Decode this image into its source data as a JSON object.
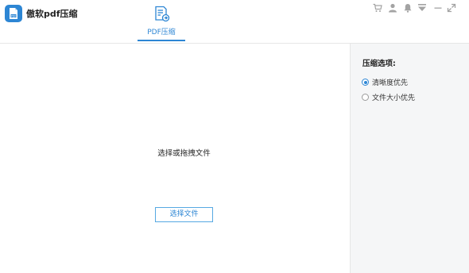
{
  "app": {
    "title": "傲软pdf压缩",
    "logo_icon": "pdf-file-icon",
    "accent_color": "#2d86d4"
  },
  "tabs": [
    {
      "label": "PDF压缩",
      "icon": "pdf-compress-icon",
      "active": true
    }
  ],
  "window_controls": [
    {
      "name": "cart-icon"
    },
    {
      "name": "user-icon"
    },
    {
      "name": "bell-icon"
    },
    {
      "name": "menu-dropdown-icon"
    },
    {
      "name": "minimize-icon"
    },
    {
      "name": "restore-icon"
    }
  ],
  "main": {
    "prompt": "选择或拖拽文件",
    "select_button_label": "选择文件"
  },
  "options": {
    "heading": "压缩选项:",
    "choices": [
      {
        "label": "清晰度优先",
        "selected": true
      },
      {
        "label": "文件大小优先",
        "selected": false
      }
    ]
  }
}
